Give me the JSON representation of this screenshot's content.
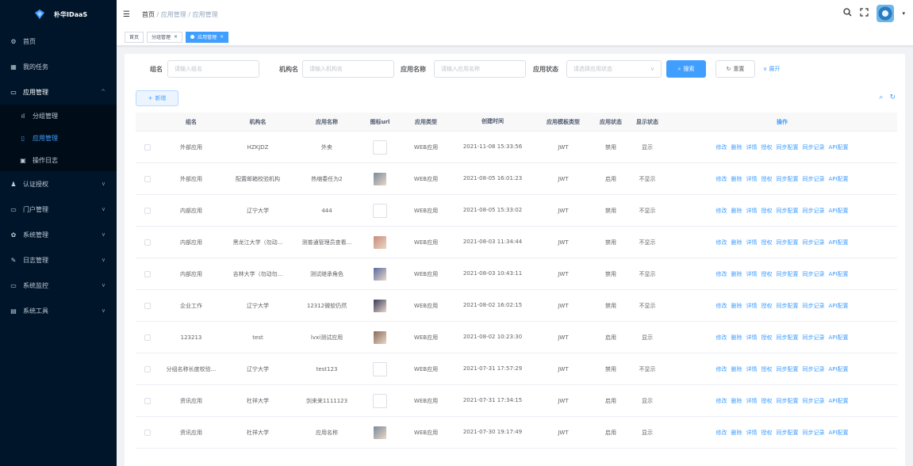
{
  "app": {
    "title": "朴华IDaaS"
  },
  "sidebar": {
    "items": [
      {
        "label": "首页",
        "icon": "dashboard-icon",
        "glyph": "⚙"
      },
      {
        "label": "我的任务",
        "icon": "task-icon",
        "glyph": "▦"
      },
      {
        "label": "应用管理",
        "icon": "app-icon",
        "glyph": "▭",
        "open": true
      },
      {
        "label": "分组管理",
        "icon": "bar-chart-icon",
        "glyph": "ıl",
        "sub": true
      },
      {
        "label": "应用管理",
        "icon": "mobile-icon",
        "glyph": "▯",
        "sub": true,
        "active": true
      },
      {
        "label": "操作日志",
        "icon": "log-icon",
        "glyph": "▣",
        "sub": true
      },
      {
        "label": "认证授权",
        "icon": "user-icon",
        "glyph": "♟",
        "chevron": true
      },
      {
        "label": "门户管理",
        "icon": "portal-icon",
        "glyph": "▭",
        "chevron": true
      },
      {
        "label": "系统管理",
        "icon": "gear-icon",
        "glyph": "✿",
        "chevron": true
      },
      {
        "label": "日志管理",
        "icon": "edit-icon",
        "glyph": "✎",
        "chevron": true
      },
      {
        "label": "系统监控",
        "icon": "monitor-icon",
        "glyph": "▭",
        "chevron": true
      },
      {
        "label": "系统工具",
        "icon": "toolbox-icon",
        "glyph": "▤",
        "chevron": true
      }
    ]
  },
  "header": {
    "breadcrumb": [
      "首页",
      "应用管理",
      "应用管理"
    ],
    "separator": "/"
  },
  "tags": [
    {
      "label": "首页",
      "active": false,
      "closable": false
    },
    {
      "label": "分组管理",
      "active": false,
      "closable": true
    },
    {
      "label": "应用管理",
      "active": true,
      "closable": true
    }
  ],
  "search": {
    "group_label": "组名",
    "group_placeholder": "请输入组名",
    "org_label": "机构名",
    "org_placeholder": "请输入机构名",
    "app_label": "应用名称",
    "app_placeholder": "请输入应用名称",
    "status_label": "应用状态",
    "status_placeholder": "请选择应用状态",
    "search_btn": "搜索",
    "reset_btn": "重置",
    "expand": "展开"
  },
  "toolbar": {
    "add_label": "新增"
  },
  "table": {
    "headers": [
      "组名",
      "机构名",
      "应用名称",
      "图标url",
      "应用类型",
      "创建时间",
      "应用模板类型",
      "应用状态",
      "显示状态",
      "操作"
    ],
    "ops": [
      "修改",
      "删除",
      "详情",
      "授权",
      "同步配置",
      "同步记录",
      "API配置"
    ],
    "rows": [
      {
        "group": "外部应用",
        "org": "HZKJDZ",
        "app": "外卖",
        "icon": "",
        "type": "WEB应用",
        "time": "2021-11-08 15:33:56",
        "tpl": "JWT",
        "status": "禁用",
        "show": "显示"
      },
      {
        "group": "外部应用",
        "org": "配置邮箱校验机构",
        "app": "热缩委任为2",
        "icon": "#7a8a9a",
        "type": "WEB应用",
        "time": "2021-08-05 16:01:23",
        "tpl": "JWT",
        "status": "启用",
        "show": "不显示"
      },
      {
        "group": "内部应用",
        "org": "辽宁大学",
        "app": "444",
        "icon": "",
        "type": "WEB应用",
        "time": "2021-08-05 15:33:02",
        "tpl": "JWT",
        "status": "禁用",
        "show": "不显示"
      },
      {
        "group": "内部应用",
        "org": "黑龙江大学（勿动...",
        "app": "测普通管理员查看...",
        "icon": "#c98a7a",
        "type": "WEB应用",
        "time": "2021-08-03 11:34:44",
        "tpl": "JWT",
        "status": "禁用",
        "show": "不显示"
      },
      {
        "group": "内部应用",
        "org": "吉林大学（勿动勿...",
        "app": "测试继承角色",
        "icon": "#5a6aa0",
        "type": "WEB应用",
        "time": "2021-08-03 10:43:11",
        "tpl": "JWT",
        "status": "禁用",
        "show": "不显示"
      },
      {
        "group": "企业工作",
        "org": "辽宁大学",
        "app": "12312微软仍然",
        "icon": "#3a3a5a",
        "type": "WEB应用",
        "time": "2021-08-02 16:02:15",
        "tpl": "JWT",
        "status": "禁用",
        "show": "不显示"
      },
      {
        "group": "123213",
        "org": "test",
        "app": "lvxi测试应用",
        "icon": "#8a6a5a",
        "type": "WEB应用",
        "time": "2021-08-02 10:23:30",
        "tpl": "JWT",
        "status": "启用",
        "show": "显示"
      },
      {
        "group": "分组名称长度校验...",
        "org": "辽宁大学",
        "app": "test123",
        "icon": "",
        "type": "WEB应用",
        "time": "2021-07-31 17:57:29",
        "tpl": "JWT",
        "status": "禁用",
        "show": "不显示"
      },
      {
        "group": "资讯应用",
        "org": "杜祥大学",
        "app": "剑来来1111123",
        "icon": "",
        "type": "WEB应用",
        "time": "2021-07-31 17:34:15",
        "tpl": "JWT",
        "status": "启用",
        "show": "显示"
      },
      {
        "group": "资讯应用",
        "org": "杜祥大学",
        "app": "应用名称",
        "icon": "#7a8a9a",
        "type": "WEB应用",
        "time": "2021-07-30 19:17:49",
        "tpl": "JWT",
        "status": "启用",
        "show": "显示"
      }
    ]
  },
  "colors": {
    "sidebar_bg": "#001529",
    "primary": "#409eff"
  }
}
